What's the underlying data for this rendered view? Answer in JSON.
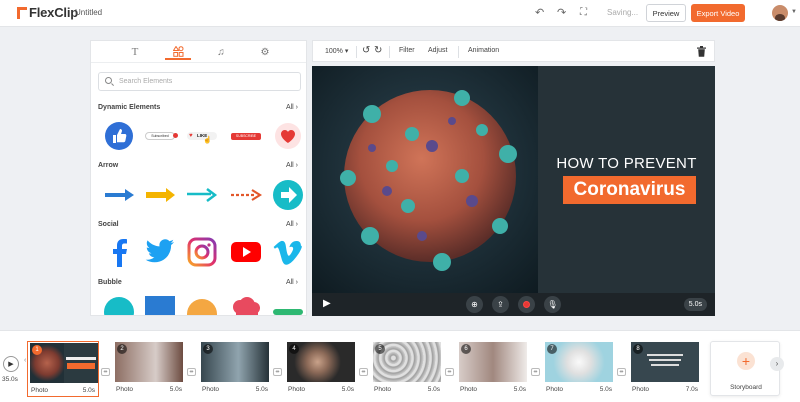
{
  "app": {
    "brand": "FlexClip",
    "doc_title": "Untitled",
    "saving": "Saving...",
    "preview_label": "Preview",
    "export_label": "Export Video",
    "accent": "#f26a2e"
  },
  "panel": {
    "tabs": [
      "text-icon",
      "elements-icon",
      "music-icon",
      "settings-icon"
    ],
    "search_placeholder": "Search Elements",
    "sections": [
      {
        "title": "Dynamic Elements",
        "all": "All"
      },
      {
        "title": "Arrow",
        "all": "All"
      },
      {
        "title": "Social",
        "all": "All"
      },
      {
        "title": "Bubble",
        "all": "All"
      }
    ],
    "dynamic_items": {
      "subscribed": "Subscribed",
      "like": "LIKE",
      "subscribe": "SUBSCRIBE"
    }
  },
  "toolbar": {
    "zoom": "100%",
    "filter": "Filter",
    "adjust": "Adjust",
    "animation": "Animation"
  },
  "video": {
    "title_line1": "HOW TO PREVENT",
    "title_line2": "Coronavirus",
    "duration": "5.0s"
  },
  "timeline": {
    "total": "35.0s",
    "clips": [
      {
        "num": "1",
        "type": "Photo",
        "dur": "5.0s"
      },
      {
        "num": "2",
        "type": "Photo",
        "dur": "5.0s"
      },
      {
        "num": "3",
        "type": "Photo",
        "dur": "5.0s"
      },
      {
        "num": "4",
        "type": "Photo",
        "dur": "5.0s"
      },
      {
        "num": "5",
        "type": "Photo",
        "dur": "5.0s"
      },
      {
        "num": "6",
        "type": "Photo",
        "dur": "5.0s"
      },
      {
        "num": "7",
        "type": "Photo",
        "dur": "5.0s"
      },
      {
        "num": "8",
        "type": "Photo",
        "dur": "7.0s"
      }
    ],
    "storyboard_label": "Storyboard"
  }
}
